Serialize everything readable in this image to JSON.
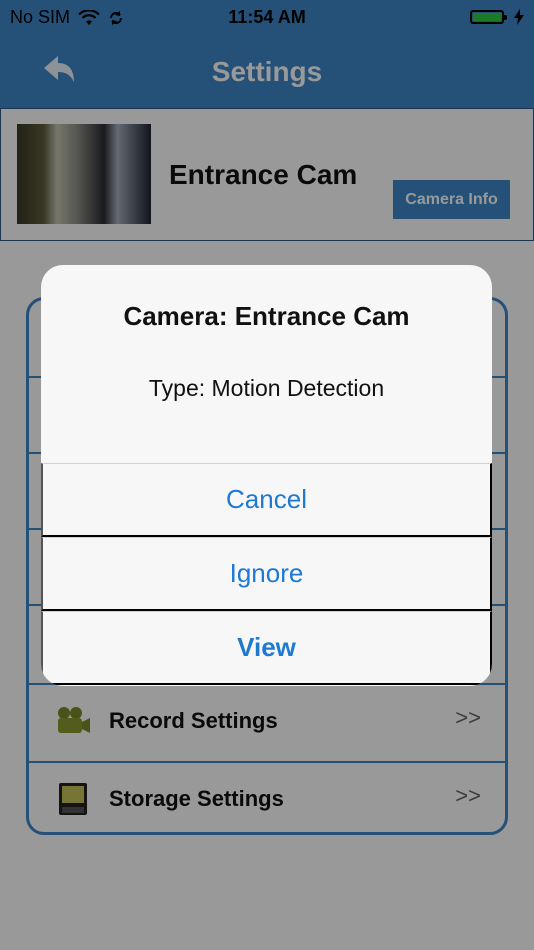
{
  "status": {
    "carrier": "No SIM",
    "time": "11:54 AM"
  },
  "nav": {
    "title": "Settings",
    "back_icon": "back-arrow-icon"
  },
  "camera": {
    "name": "Entrance Cam",
    "info_button": "Camera Info"
  },
  "settings": {
    "items": [
      {
        "label": "Record Settings",
        "icon": "video-camera-icon",
        "chevron": ">>"
      },
      {
        "label": "Storage Settings",
        "icon": "sd-card-icon",
        "chevron": ">>"
      }
    ]
  },
  "alert": {
    "title": "Camera: Entrance Cam",
    "message": "Type: Motion Detection",
    "buttons": {
      "cancel": "Cancel",
      "ignore": "Ignore",
      "view": "View"
    }
  },
  "colors": {
    "brand_blue": "#3f86c8",
    "alert_button_blue": "#1e79d2"
  }
}
